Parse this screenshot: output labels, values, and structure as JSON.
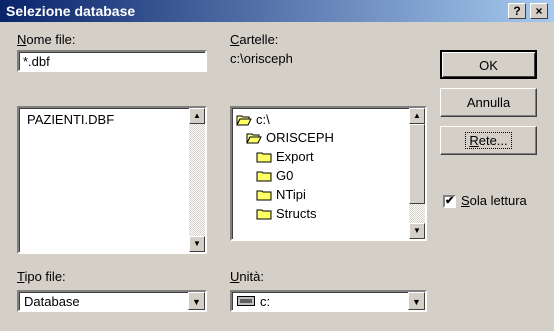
{
  "window": {
    "title": "Selezione database",
    "help_label": "?",
    "close_label": "×"
  },
  "filename": {
    "label_key": "N",
    "label_rest": "ome file:",
    "value": "*.dbf",
    "files": [
      "PAZIENTI.DBF"
    ]
  },
  "folders": {
    "label_key": "C",
    "label_rest": "artelle:",
    "current_path": "c:\\orisceph",
    "tree": [
      {
        "name": "c:\\",
        "icon": "open-folder-icon"
      },
      {
        "name": "ORISCEPH",
        "icon": "open-folder-icon"
      },
      {
        "name": "Export",
        "icon": "folder-icon"
      },
      {
        "name": "G0",
        "icon": "folder-icon"
      },
      {
        "name": "NTipi",
        "icon": "folder-icon"
      },
      {
        "name": "Structs",
        "icon": "folder-icon"
      }
    ]
  },
  "buttons": {
    "ok": "OK",
    "cancel": "Annulla",
    "network_key": "R",
    "network_rest": "ete..."
  },
  "readonly": {
    "key": "S",
    "rest": "ola lettura",
    "checked": true,
    "check_glyph": "✔"
  },
  "filetype": {
    "label_key": "T",
    "label_rest": "ipo file:",
    "value": "Database"
  },
  "drive": {
    "label_key": "U",
    "label_rest": "nità:",
    "value": "c:"
  }
}
